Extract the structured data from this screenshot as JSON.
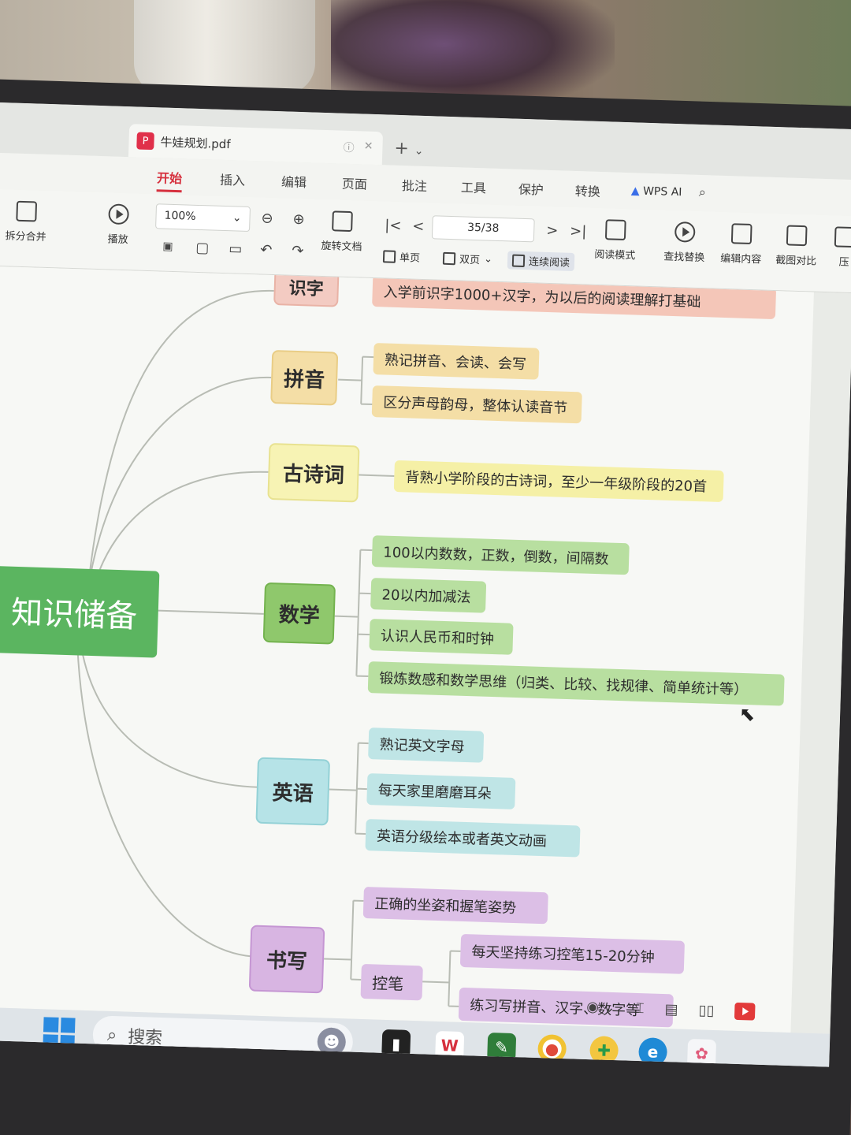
{
  "window": {
    "tab_title": "牛娃规划.pdf",
    "new_tab": "+"
  },
  "menu": {
    "items": [
      "开始",
      "插入",
      "编辑",
      "页面",
      "批注",
      "工具",
      "保护",
      "转换",
      "WPS AI"
    ]
  },
  "toolbar": {
    "split_merge": "拆分合并",
    "play": "播放",
    "zoom": "100%",
    "rotate": "旋转文档",
    "single_page": "单页",
    "double_page": "双页",
    "continuous": "连续阅读",
    "read_mode": "阅读模式",
    "page_indicator": "35/38",
    "find_replace": "查找替换",
    "edit_content": "编辑内容",
    "screenshot_compare": "截图对比",
    "compress": "压"
  },
  "mindmap": {
    "root": "知识储备",
    "top_cut": {
      "category": "识字",
      "leaf": "入学前识字1000+汉字，为以后的阅读理解打基础"
    },
    "categories": [
      {
        "label": "拼音",
        "items": [
          "熟记拼音、会读、会写",
          "区分声母韵母，整体认读音节"
        ]
      },
      {
        "label": "古诗词",
        "items": [
          "背熟小学阶段的古诗词，至少一年级阶段的20首"
        ]
      },
      {
        "label": "数学",
        "items": [
          "100以内数数，正数，倒数，间隔数",
          "20以内加减法",
          "认识人民币和时钟",
          "锻炼数感和数学思维（归类、比较、找规律、简单统计等）"
        ]
      },
      {
        "label": "英语",
        "items": [
          "熟记英文字母",
          "每天家里磨磨耳朵",
          "英语分级绘本或者英文动画"
        ]
      },
      {
        "label": "书写",
        "items": [
          "正确的坐姿和握笔姿势"
        ],
        "sub": {
          "label": "控笔",
          "items": [
            "每天坚持练习控笔15-20分钟",
            "练习写拼音、汉字、数字等"
          ]
        }
      }
    ]
  },
  "taskbar": {
    "search": "搜索"
  }
}
